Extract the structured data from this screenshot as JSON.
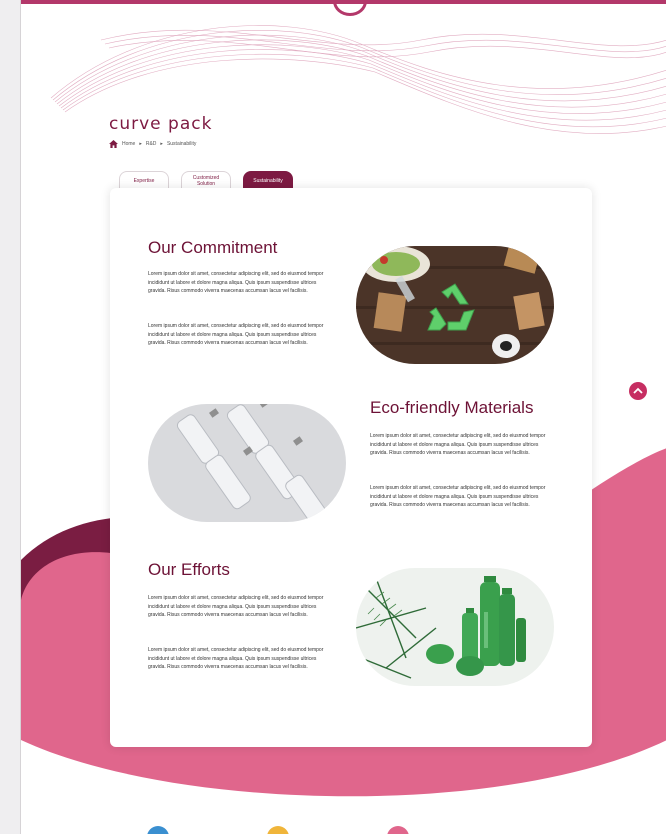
{
  "brand": {
    "logo_text": "curve pack"
  },
  "breadcrumb": [
    "Home",
    "R&D",
    "Sustainability"
  ],
  "tabs": [
    {
      "label": "Expertise",
      "active": false
    },
    {
      "label": "Customized Solution",
      "active": false
    },
    {
      "label": "Sustainability",
      "active": true
    }
  ],
  "sections": [
    {
      "title": "Our Commitment",
      "paragraphs": [
        "Lorem ipsum dolor sit amet, consectetur adipiscing elit, sed do eiusmod tempor incididunt ut labore et dolore magna aliqua. Quis ipsum suspendisse ultrices gravida. Risus commodo viverra maecenas accumsan lacus vel facilisis.",
        "Lorem ipsum dolor sit amet, consectetur adipiscing elit, sed do eiusmod tempor incididunt ut labore et dolore magna aliqua. Quis ipsum suspendisse ultrices gravida. Risus commodo viverra maecenas accumsan lacus vel facilisis."
      ],
      "image": "recycling-symbol-photo"
    },
    {
      "title": "Eco-friendly Materials",
      "paragraphs": [
        "Lorem ipsum dolor sit amet, consectetur adipiscing elit, sed do eiusmod tempor incididunt ut labore et dolore magna aliqua. Quis ipsum suspendisse ultrices gravida. Risus commodo viverra maecenas accumsan lacus vel facilisis.",
        "Lorem ipsum dolor sit amet, consectetur adipiscing elit, sed do eiusmod tempor incididunt ut labore et dolore magna aliqua. Quis ipsum suspendisse ultrices gravida. Risus commodo viverra maecenas accumsan lacus vel facilisis."
      ],
      "image": "glass-bottles-photo"
    },
    {
      "title": "Our Efforts",
      "paragraphs": [
        "Lorem ipsum dolor sit amet, consectetur adipiscing elit, sed do eiusmod tempor incididunt ut labore et dolore magna aliqua. Quis ipsum suspendisse ultrices gravida. Risus commodo viverra maecenas accumsan lacus vel facilisis.",
        "Lorem ipsum dolor sit amet, consectetur adipiscing elit, sed do eiusmod tempor incididunt ut labore et dolore magna aliqua. Quis ipsum suspendisse ultrices gravida. Risus commodo viverra maecenas accumsan lacus vel facilisis."
      ],
      "image": "green-cosmetic-bottles-photo"
    }
  ],
  "colors": {
    "brand": "#7d1a42",
    "pink": "#e0668c",
    "accent": "#c62e62"
  },
  "icons": {
    "home": "home-icon",
    "scroll_top": "chevron-up-icon"
  }
}
